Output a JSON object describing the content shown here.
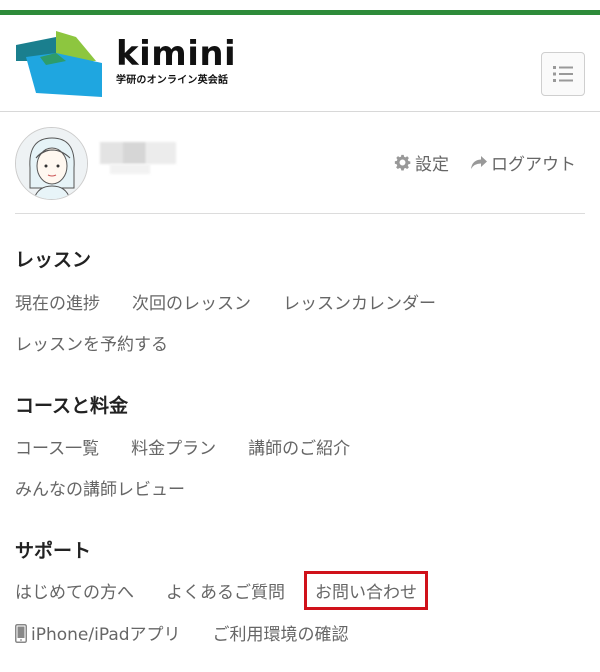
{
  "brand": {
    "name": "kimini",
    "tagline": "学研のオンライン英会話",
    "colors": {
      "green": "#8dc63f",
      "darkgreen": "#2e8b3a",
      "blue": "#1fa6e0",
      "teal": "#1a7f8e"
    }
  },
  "header": {
    "menu_icon": "list-icon"
  },
  "profile": {
    "settings_label": "設定",
    "logout_label": "ログアウト"
  },
  "sections": {
    "lesson": {
      "title": "レッスン",
      "items": [
        "現在の進捗",
        "次回のレッスン",
        "レッスンカレンダー",
        "レッスンを予約する"
      ]
    },
    "course": {
      "title": "コースと料金",
      "items": [
        "コース一覧",
        "料金プラン",
        "講師のご紹介",
        "みんなの講師レビュー"
      ]
    },
    "support": {
      "title": "サポート",
      "items": [
        "はじめての方へ",
        "よくあるご質問",
        "お問い合わせ",
        "iPhone/iPadアプリ",
        "ご利用環境の確認"
      ]
    }
  },
  "highlight_color": "#d0111a"
}
